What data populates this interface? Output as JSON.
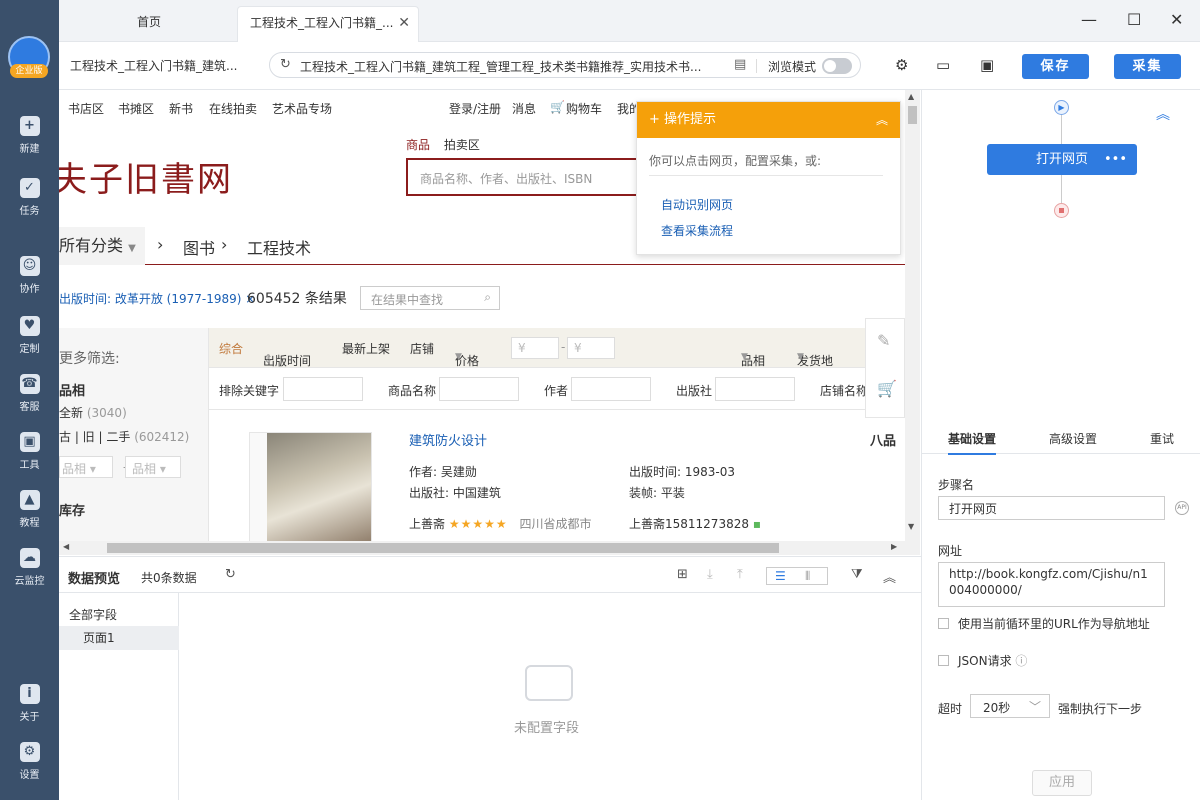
{
  "sidebar": {
    "logo_badge": "企业版",
    "items": [
      {
        "label": "新建",
        "icon": "plus-icon"
      },
      {
        "label": "任务",
        "icon": "task-icon"
      },
      {
        "label": "协作",
        "icon": "users-icon"
      },
      {
        "label": "定制",
        "icon": "heart-icon"
      },
      {
        "label": "客服",
        "icon": "headset-icon"
      },
      {
        "label": "工具",
        "icon": "toolbox-icon"
      },
      {
        "label": "教程",
        "icon": "graduation-icon"
      },
      {
        "label": "云监控",
        "icon": "cloud-icon"
      },
      {
        "label": "关于",
        "icon": "info-icon"
      },
      {
        "label": "设置",
        "icon": "gear-icon"
      }
    ]
  },
  "tabs": [
    {
      "label": "首页"
    },
    {
      "label": "工程技术_工程入门书籍_..."
    }
  ],
  "addrbar": {
    "page_title": "工程技术_工程入门书籍_建筑...",
    "url": "工程技术_工程入门书籍_建筑工程_管理工程_技术类书籍推荐_实用技术书...",
    "browse_mode": "浏览模式",
    "save": "保存",
    "collect": "采集"
  },
  "web": {
    "nav": [
      "书店区",
      "书摊区",
      "新书",
      "在线拍卖",
      "艺术品专场"
    ],
    "nav_right": [
      "登录/注册",
      "消息",
      "购物车",
      "我的"
    ],
    "logo": "夫子旧書网",
    "search_tabs": [
      "商品",
      "拍卖区"
    ],
    "search_placeholder": "商品名称、作者、出版社、ISBN",
    "cat_all": "所有分类",
    "crumbs": [
      "图书",
      "工程技术"
    ],
    "filter_chip": "出版时间: 改革开放 (1977-1989) ×",
    "result_count": "605452 条结果",
    "in_result": "在结果中查找",
    "left_filter": {
      "more": "更多筛选:",
      "title": "品相",
      "opt1": "全新",
      "opt1_count": "(3040)",
      "opt2": "古 | 旧 | 二手",
      "opt2_count": "(602412)",
      "sel": "品相",
      "stock": "库存"
    },
    "sort": [
      "综合",
      "出版时间",
      "最新上架",
      "店铺",
      "价格",
      "品相",
      "发货地"
    ],
    "price_from": "¥",
    "price_to": "¥",
    "fields": [
      "排除关键字",
      "商品名称",
      "作者",
      "出版社",
      "店铺名称"
    ],
    "item": {
      "title": "建筑防火设计",
      "author": "作者: 吴建勋",
      "date": "出版时间: 1983-03",
      "publisher": "出版社: 中国建筑",
      "binding": "装帧: 平装",
      "shop": "上善斋",
      "stars": "★★★★★",
      "location": "四川省成都市",
      "phone": "上善斋15811273828",
      "condition": "八品"
    }
  },
  "tip": {
    "title": "操作提示",
    "hint": "你可以点击网页，配置采集，或:",
    "link1": "自动识别网页",
    "link2": "查看采集流程"
  },
  "preview": {
    "title": "数据预览",
    "count": "共0条数据",
    "all_fields": "全部字段",
    "page1": "页面1",
    "empty": "未配置字段"
  },
  "right": {
    "step": "打开网页",
    "tabs": [
      "基础设置",
      "高级设置",
      "重试"
    ],
    "step_name_label": "步骤名",
    "step_name": "打开网页",
    "url_label": "网址",
    "url_value": "http://book.kongfz.com/Cjishu/n1004000000/",
    "use_loop": "使用当前循环里的URL作为导航地址",
    "json": "JSON请求",
    "timeout_label": "超时",
    "timeout": "20秒",
    "force": "强制执行下一步",
    "apply": "应用"
  },
  "colors": {
    "sidebar": "#3a506b",
    "accent": "#2f7be0",
    "tip_orange": "#f5a00a",
    "brand_red": "#8b1c1c"
  }
}
